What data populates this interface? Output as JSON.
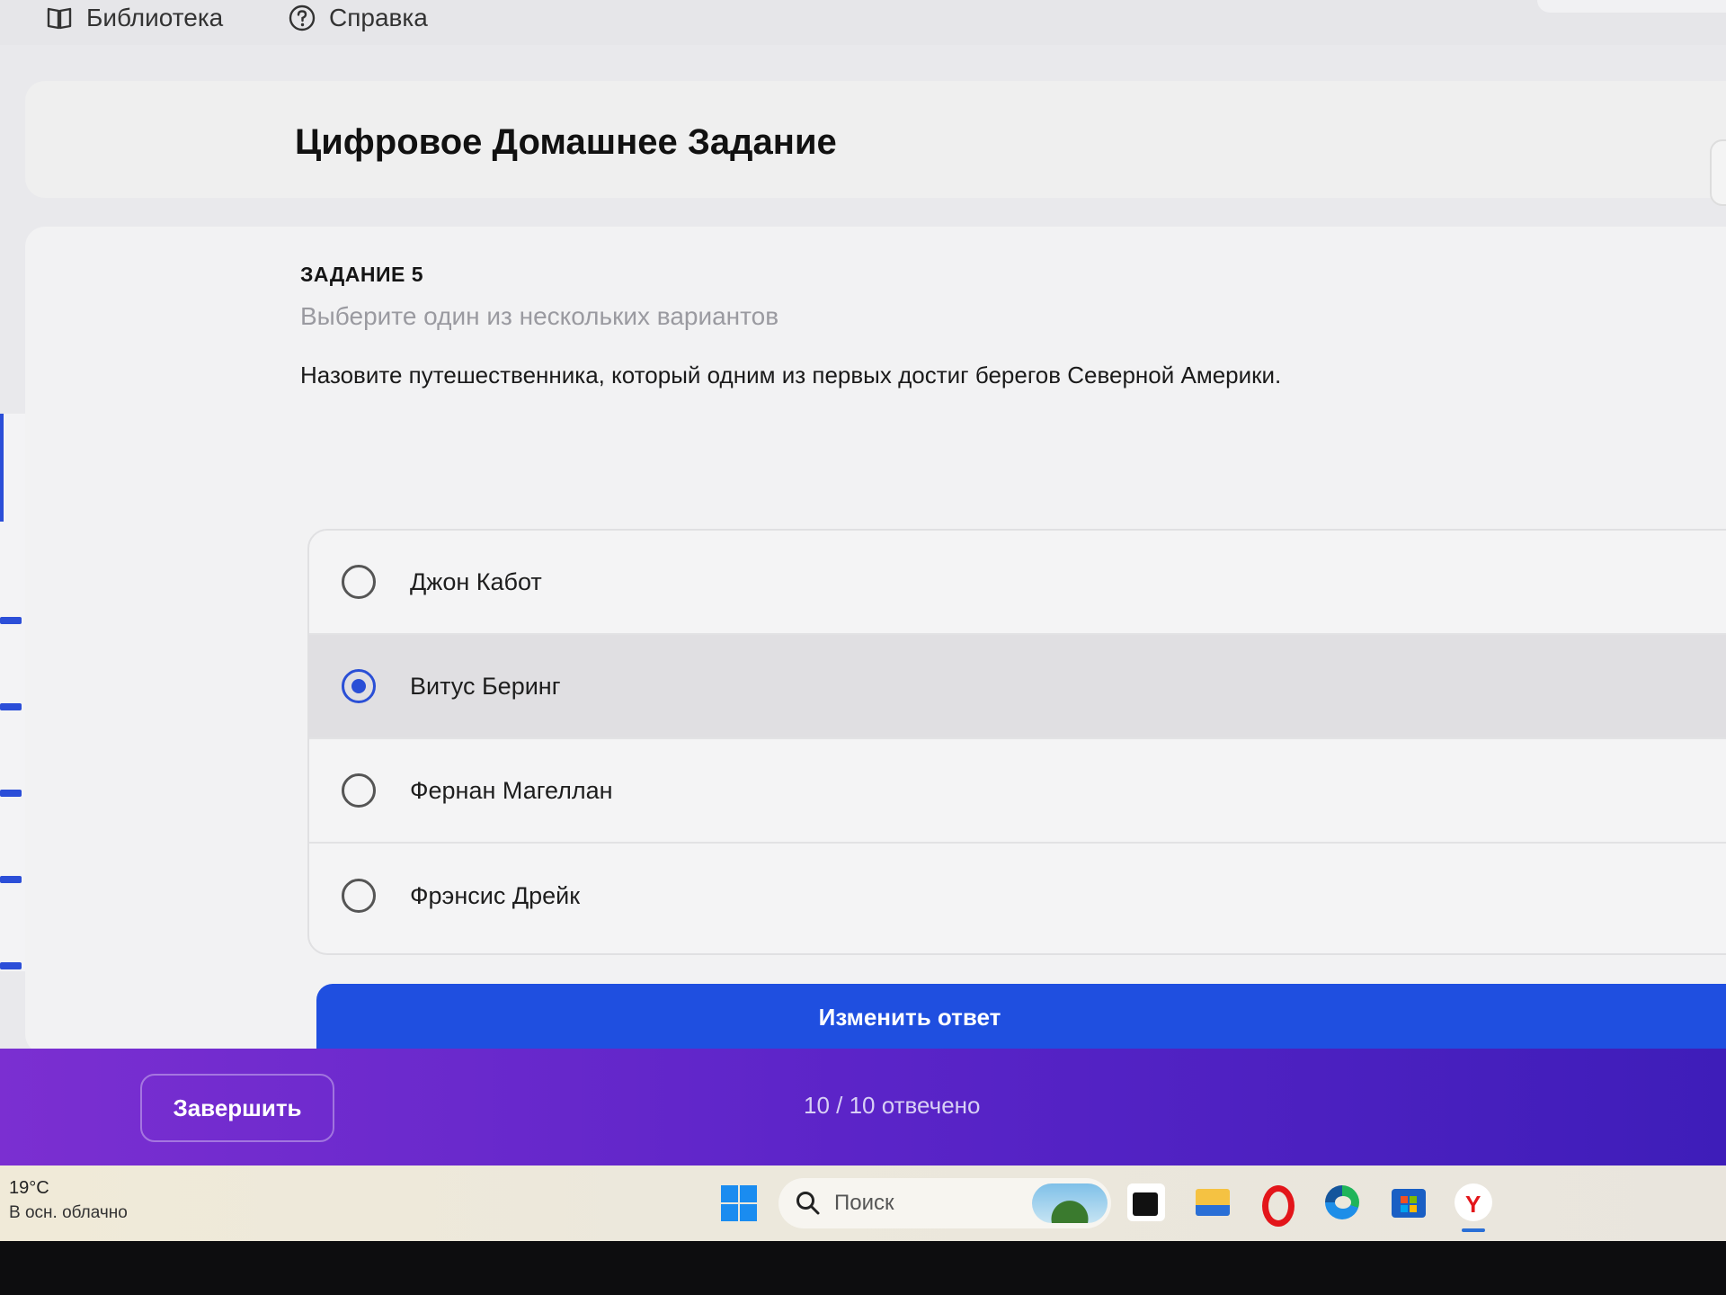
{
  "nav": {
    "library_label": "Библиотека",
    "help_label": "Справка"
  },
  "header": {
    "title": "Цифровое Домашнее Задание"
  },
  "task": {
    "number_label": "ЗАДАНИЕ 5",
    "hint": "Выберите один из нескольких вариантов",
    "question": "Назовите путешественника, который одним из первых достиг берегов Северной Америки."
  },
  "options": [
    {
      "label": "Джон Кабот",
      "selected": false
    },
    {
      "label": "Витус Беринг",
      "selected": true
    },
    {
      "label": "Фернан Магеллан",
      "selected": false
    },
    {
      "label": "Фрэнсис Дрейк",
      "selected": false
    }
  ],
  "actions": {
    "change_answer_label": "Изменить ответ",
    "finish_label": "Завершить",
    "answered_status": "10 / 10 отвечено"
  },
  "taskbar": {
    "weather_temp": "19°C",
    "weather_desc": "В осн. облачно",
    "search_placeholder": "Поиск",
    "icons": [
      "windows-start-icon",
      "search-icon",
      "task-view-icon",
      "file-explorer-icon",
      "opera-icon",
      "edge-icon",
      "store-icon",
      "yandex-browser-icon"
    ]
  },
  "colors": {
    "accent_blue": "#1f4fe0",
    "bottom_bar_start": "#7b2fd1",
    "bottom_bar_end": "#3e1db9"
  }
}
